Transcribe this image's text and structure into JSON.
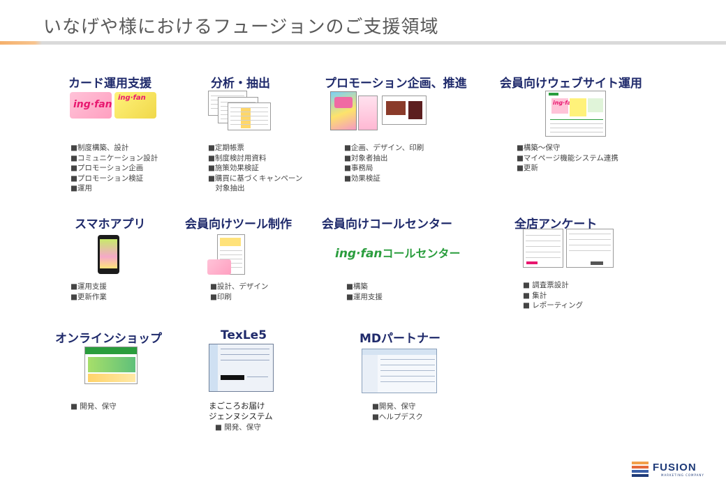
{
  "page": {
    "title": "いなげや様におけるフュージョンのご支援領域"
  },
  "sections": [
    {
      "heading": "カード運用支援",
      "bullets": [
        "■制度構築、設計",
        "■コミュニケーション設計",
        "■プロモーション企画",
        "■プロモーション検証",
        "■運用"
      ]
    },
    {
      "heading": "分析・抽出",
      "bullets": [
        "■定期帳票",
        "■制度検討用資料",
        "■施策効果検証",
        "■購買に基づくキャンペーン",
        "　対象抽出"
      ]
    },
    {
      "heading": "プロモーション企画、推進",
      "bullets": [
        "■企画、デザイン、印刷",
        "■対象者抽出",
        "■事務局",
        "■効果検証"
      ]
    },
    {
      "heading": "会員向けウェブサイト運用",
      "bullets": [
        "■構築～保守",
        "■マイページ機能システム連携",
        "■更新"
      ]
    },
    {
      "heading": "スマホアプリ",
      "bullets": [
        "■運用支援",
        "■更新作業"
      ]
    },
    {
      "heading": "会員向けツール制作",
      "bullets": [
        "■設計、デザイン",
        "■印刷"
      ]
    },
    {
      "heading": "会員向けコールセンター",
      "bullets": [
        "■構築",
        "■運用支援"
      ]
    },
    {
      "heading": "全店アンケート",
      "bullets": [
        "■ 調査票設計",
        "■ 集計",
        "■ レポーティング"
      ]
    },
    {
      "heading": "オンラインショップ",
      "bullets": [
        "■ 開発、保守"
      ]
    },
    {
      "heading": "TexLe5",
      "caption": [
        "まごころお届け",
        "ジェンヌシステム"
      ],
      "bullets": [
        "■ 開発、保守"
      ]
    },
    {
      "heading": "MDパートナー",
      "bullets": [
        "■開発、保守",
        "■ヘルプデスク"
      ]
    }
  ],
  "thumbnails": {
    "card_logo": "ing·fan",
    "callcenter_logo": "ing·fan",
    "callcenter_text": "コールセンター"
  },
  "footer": {
    "brand": "FUSION",
    "brand_sub": "MARKETING COMPANY"
  },
  "colors": {
    "heading": "#1f2a6b",
    "accent_orange": "#f5b06b",
    "rule_gray": "#dadada",
    "brand_pink": "#e8176f",
    "brand_green": "#2a9d3d",
    "fusion_blue": "#1e3a78"
  },
  "icons": [
    "card-thumbnail",
    "report-thumbnail",
    "flyer-thumbnail",
    "website-thumbnail",
    "smartphone-thumbnail",
    "tool-thumbnail",
    "callcenter-logo",
    "survey-thumbnail",
    "shop-thumbnail",
    "texle5-thumbnail",
    "mdpartner-thumbnail",
    "fusion-logo"
  ]
}
